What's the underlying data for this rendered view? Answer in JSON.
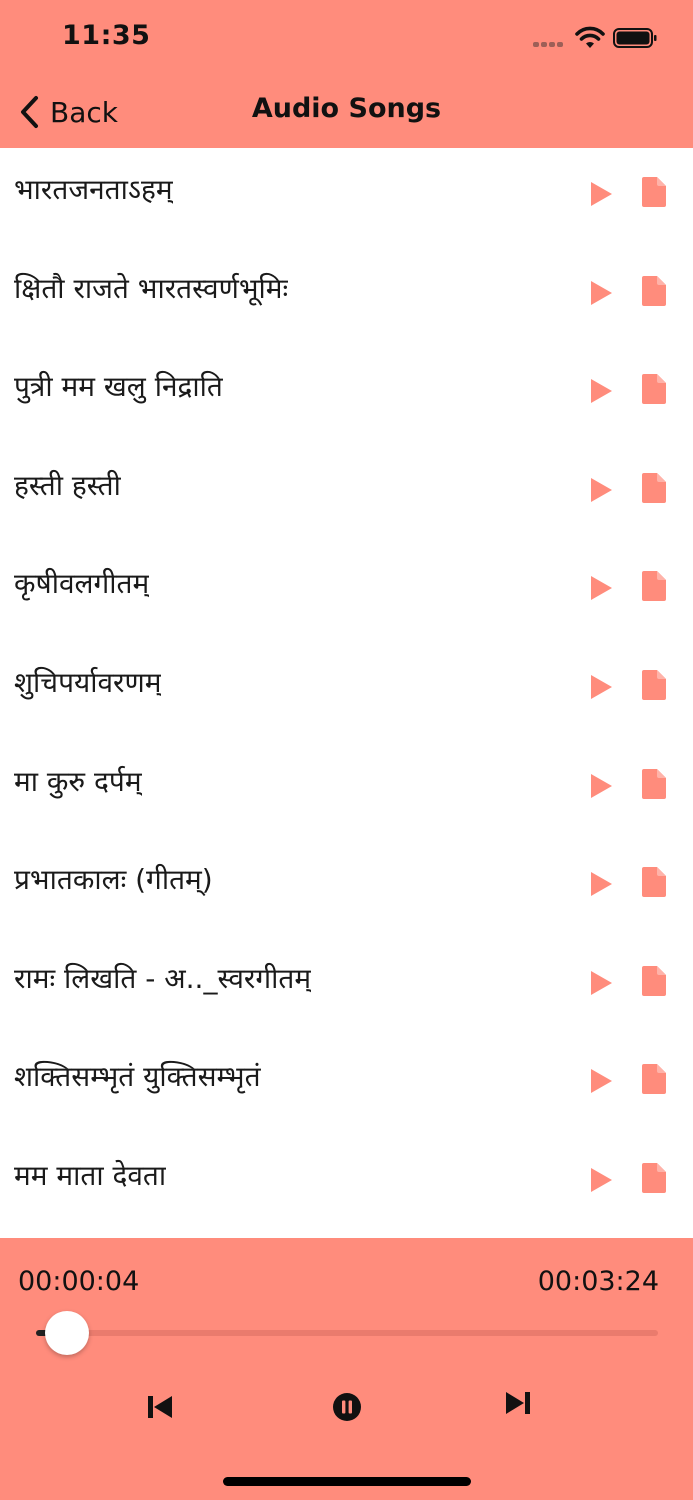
{
  "status_bar": {
    "time": "11:35"
  },
  "nav": {
    "back_label": "Back",
    "title": "Audio Songs"
  },
  "colors": {
    "accent": "#ff8c7c",
    "icon": "#ff8c7c",
    "text": "#111111"
  },
  "songs": [
    {
      "title": "भारतजनताऽहम्",
      "play_icon": "play-icon",
      "doc_icon": "document-icon"
    },
    {
      "title": "क्षितौ राजते भारतस्वर्णभूमिः",
      "play_icon": "play-icon",
      "doc_icon": "document-icon"
    },
    {
      "title": "पुत्री मम खलु निद्राति",
      "play_icon": "play-icon",
      "doc_icon": "document-icon"
    },
    {
      "title": "हस्ती हस्ती",
      "play_icon": "play-icon",
      "doc_icon": "document-icon"
    },
    {
      "title": "कृषीवलगीतम्",
      "play_icon": "play-icon",
      "doc_icon": "document-icon"
    },
    {
      "title": "शुचिपर्यावरणम्",
      "play_icon": "play-icon",
      "doc_icon": "document-icon"
    },
    {
      "title": "मा कुरु दर्पम्",
      "play_icon": "play-icon",
      "doc_icon": "document-icon"
    },
    {
      "title": "प्रभातकालः (गीतम्)",
      "play_icon": "play-icon",
      "doc_icon": "document-icon"
    },
    {
      "title": "रामः लिखति - अ.._स्वरगीतम्",
      "play_icon": "play-icon",
      "doc_icon": "document-icon"
    },
    {
      "title": "शक्तिसम्भृतं युक्तिसम्भृतं",
      "play_icon": "play-icon",
      "doc_icon": "document-icon"
    },
    {
      "title": "मम माता देवता",
      "play_icon": "play-icon",
      "doc_icon": "document-icon"
    }
  ],
  "player": {
    "elapsed": "00:00:04",
    "total": "00:03:24",
    "progress": 0.05,
    "controls": [
      "previous-track-icon",
      "pause-icon",
      "next-track-icon"
    ]
  }
}
